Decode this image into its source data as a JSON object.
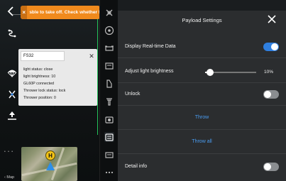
{
  "warning": {
    "close_glyph": "×",
    "text": "sble to take off. Check whether f"
  },
  "status_panel": {
    "device_value": "FS32",
    "close_glyph": "✕",
    "lines": [
      "light status: close",
      "light brightness: 10",
      "GL60P connected",
      "Thrower lock status: lock",
      "Thrower position: 0"
    ]
  },
  "map": {
    "pin_label": "H",
    "label": "‹ Map",
    "dots": "• • •"
  },
  "toolbar": {
    "icons": [
      "grid-icon",
      "compass-icon",
      "drone-icon",
      "screen-icon",
      "flashlight-icon",
      "thrower-icon",
      "payload-icon",
      "speaker-icon",
      "monitor-icon",
      "more-icon"
    ]
  },
  "modal": {
    "title": "Payload Settings",
    "rows": {
      "display_realtime": {
        "label": "Display Real-time Data",
        "on": true
      },
      "brightness": {
        "label": "Adjust light brightness",
        "value_text": "10%",
        "fraction": 0.1
      },
      "unlock": {
        "label": "Unlock",
        "on": false
      },
      "throw": {
        "label": "Throw"
      },
      "throw_all": {
        "label": "Throw all"
      },
      "detail_info": {
        "label": "Detail info",
        "on": false
      }
    }
  },
  "colors": {
    "accent": "#2f7fe0",
    "warning": "#f08a1d",
    "link": "#4a9cf0",
    "frame": "#25c25a"
  }
}
